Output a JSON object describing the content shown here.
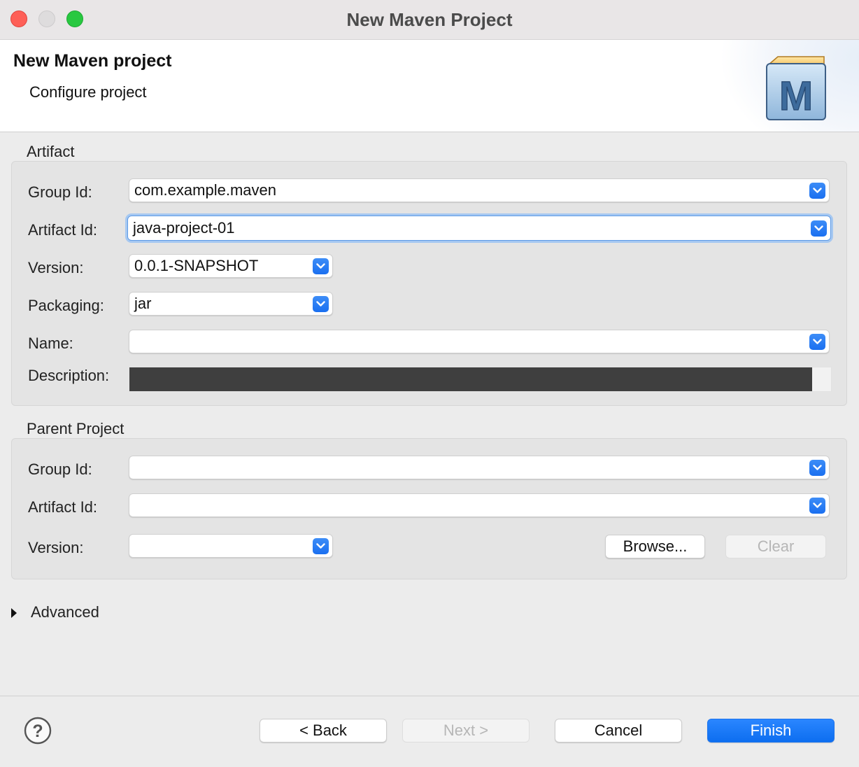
{
  "window": {
    "title": "New Maven Project"
  },
  "banner": {
    "title": "New Maven project",
    "subtitle": "Configure project",
    "logo_letter": "M"
  },
  "artifact": {
    "section_label": "Artifact",
    "group_id": {
      "label": "Group Id:",
      "value": "com.example.maven"
    },
    "artifact_id": {
      "label": "Artifact Id:",
      "value": "java-project-01"
    },
    "version": {
      "label": "Version:",
      "value": "0.0.1-SNAPSHOT"
    },
    "packaging": {
      "label": "Packaging:",
      "value": "jar"
    },
    "name": {
      "label": "Name:",
      "value": ""
    },
    "description": {
      "label": "Description:",
      "value": ""
    }
  },
  "parent": {
    "section_label": "Parent Project",
    "group_id": {
      "label": "Group Id:",
      "value": ""
    },
    "artifact_id": {
      "label": "Artifact Id:",
      "value": ""
    },
    "version": {
      "label": "Version:",
      "value": ""
    },
    "browse_label": "Browse...",
    "clear_label": "Clear"
  },
  "advanced": {
    "label": "Advanced",
    "expanded": false
  },
  "footer": {
    "help_icon": "help-icon",
    "back_label": "< Back",
    "next_label": "Next >",
    "cancel_label": "Cancel",
    "finish_label": "Finish"
  },
  "colors": {
    "accent": "#1570f0",
    "focus_ring": "#a6c8f1",
    "close": "#fe5f57",
    "maximize": "#28c840"
  }
}
